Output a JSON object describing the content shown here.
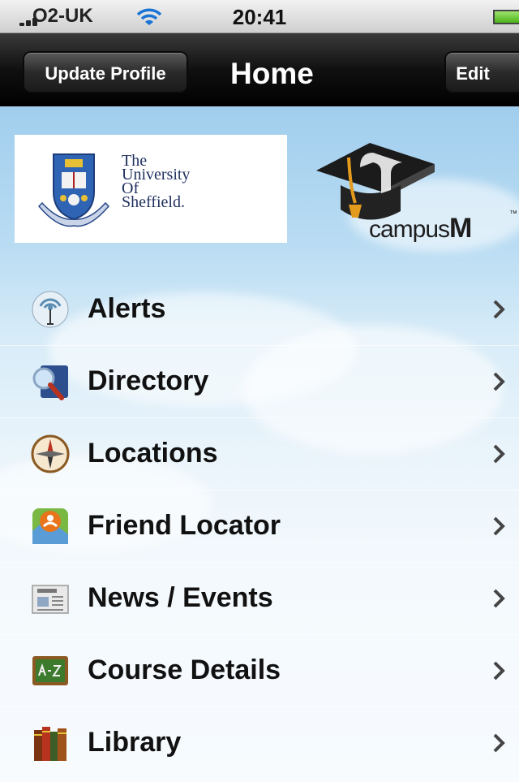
{
  "status_bar": {
    "carrier": "O2-UK",
    "time": "20:41"
  },
  "nav": {
    "title": "Home",
    "left_button": "Update Profile",
    "right_button": "Edit"
  },
  "banner": {
    "university_line1": "The",
    "university_line2": "University",
    "university_line3": "Of",
    "university_line4": "Sheffield.",
    "app_brand_a": "campus",
    "app_brand_b": "M",
    "trademark": "™"
  },
  "menu": [
    {
      "label": "Alerts",
      "icon": "antenna-icon"
    },
    {
      "label": "Directory",
      "icon": "magnifier-book-icon"
    },
    {
      "label": "Locations",
      "icon": "compass-icon"
    },
    {
      "label": "Friend Locator",
      "icon": "person-pin-icon"
    },
    {
      "label": "News / Events",
      "icon": "newspaper-icon"
    },
    {
      "label": "Course Details",
      "icon": "chalkboard-icon"
    },
    {
      "label": "Library",
      "icon": "books-icon"
    }
  ],
  "colors": {
    "navbar": "#000000",
    "sky": "#8ec3e9",
    "text": "#111111",
    "uni_blue": "#1e2f5e"
  }
}
